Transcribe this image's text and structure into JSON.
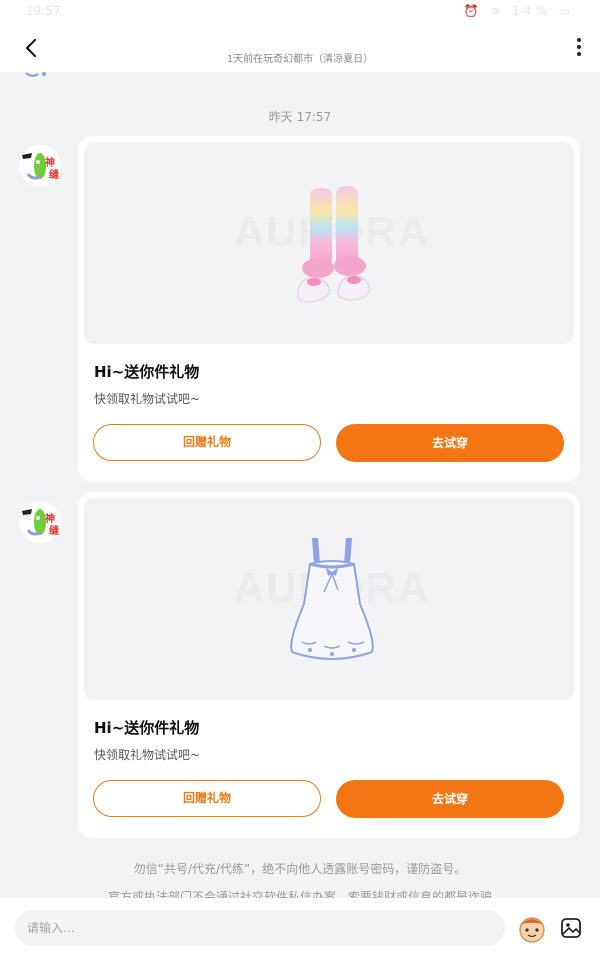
{
  "status_bar": {
    "time": "19:57",
    "icons": "⏰ ≋ 14% ▭"
  },
  "header": {
    "back_icon": "chevron-left-icon",
    "subtitle": "1天前在玩奇幻都市（清凉夏日）",
    "more_icon": "vertical-dots-icon"
  },
  "chat": {
    "timestamp": "昨天 17:57",
    "messages": [
      {
        "avatar": "神缝 character avatar",
        "item": "rainbow-leg-warmers-shoes",
        "watermark": "AURORA",
        "title": "Hi~送你件礼物",
        "subtitle": "快领取礼物试试吧~",
        "return_gift_label": "回赠礼物",
        "try_on_label": "去试穿"
      },
      {
        "avatar": "神缝 character avatar",
        "item": "white-slip-dress",
        "watermark": "AURORA",
        "title": "Hi~送你件礼物",
        "subtitle": "快领取礼物试试吧~",
        "return_gift_label": "回赠礼物",
        "try_on_label": "去试穿"
      }
    ],
    "notices": [
      "勿信“共号/代充/代练”，绝不向他人透露账号密码，谨防盗号。",
      "官方或执法部门不会通过社交软件私信办案，索要钱财或信息的都是诈骗"
    ]
  },
  "composer": {
    "placeholder": "请输入...",
    "emoji_icon": "emoji-face-icon",
    "image_icon": "image-picker-icon"
  },
  "colors": {
    "accent": "#f47514",
    "background": "#f2f3f5"
  }
}
